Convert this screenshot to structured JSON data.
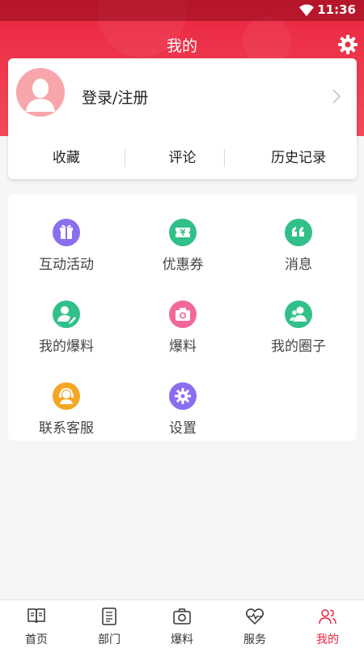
{
  "status_bar": {
    "time": "11:36"
  },
  "header": {
    "title": "我的"
  },
  "user_card": {
    "login_label": "登录/注册",
    "tabs": [
      {
        "label": "收藏"
      },
      {
        "label": "评论"
      },
      {
        "label": "历史记录"
      }
    ]
  },
  "menu": {
    "items": [
      {
        "label": "互动活动",
        "icon": "gift-icon",
        "color": "#8b6ef0"
      },
      {
        "label": "优惠券",
        "icon": "ticket-icon",
        "color": "#31c08a"
      },
      {
        "label": "消息",
        "icon": "quote-icon",
        "color": "#31c08a"
      },
      {
        "label": "我的爆料",
        "icon": "user-edit-icon",
        "color": "#31c08a"
      },
      {
        "label": "爆料",
        "icon": "camera-icon",
        "color": "#f2689a"
      },
      {
        "label": "我的圈子",
        "icon": "group-icon",
        "color": "#31c08a"
      },
      {
        "label": "联系客服",
        "icon": "headset-icon",
        "color": "#f5a623"
      },
      {
        "label": "设置",
        "icon": "settings-icon",
        "color": "#8b6ef0"
      }
    ]
  },
  "bottom_nav": {
    "items": [
      {
        "label": "首页",
        "icon": "book-icon"
      },
      {
        "label": "部门",
        "icon": "document-icon"
      },
      {
        "label": "爆料",
        "icon": "camera-icon"
      },
      {
        "label": "服务",
        "icon": "heart-pulse-icon"
      },
      {
        "label": "我的",
        "icon": "people-icon",
        "active": true
      }
    ]
  },
  "colors": {
    "brand_red": "#e9253f",
    "active_nav": "#e8253e"
  }
}
